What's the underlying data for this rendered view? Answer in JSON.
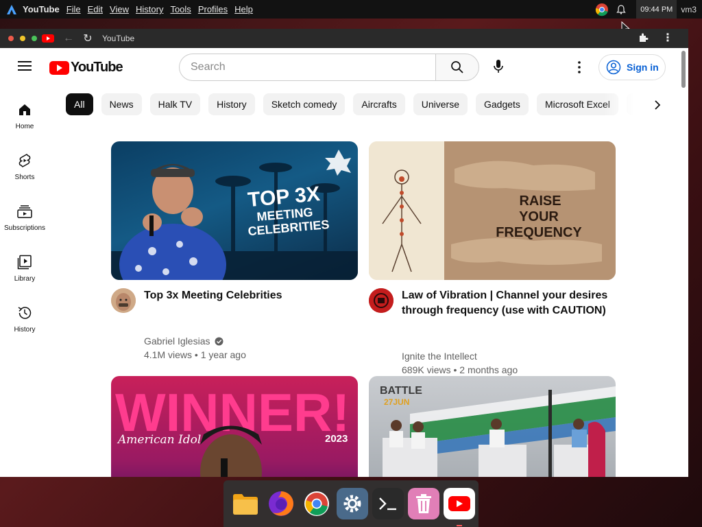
{
  "system_bar": {
    "app_name": "YouTube",
    "menu": [
      "File",
      "Edit",
      "View",
      "History",
      "Tools",
      "Profiles",
      "Help"
    ],
    "clock": "09:44 PM",
    "user": "vm3",
    "icons": [
      "chrome-icon",
      "bell-icon"
    ]
  },
  "browser": {
    "tab_title": "YouTube",
    "icons": [
      "back-arrow-icon",
      "reload-icon",
      "extensions-icon",
      "kebab-menu-icon"
    ]
  },
  "header": {
    "logo_text": "YouTube",
    "search_placeholder": "Search",
    "signin_label": "Sign in"
  },
  "chips": [
    "All",
    "News",
    "Halk TV",
    "History",
    "Sketch comedy",
    "Aircrafts",
    "Universe",
    "Gadgets",
    "Microsoft Excel"
  ],
  "sidebar": [
    {
      "label": "Home",
      "icon": "home-icon"
    },
    {
      "label": "Shorts",
      "icon": "shorts-icon"
    },
    {
      "label": "Subscriptions",
      "icon": "subscriptions-icon"
    },
    {
      "label": "Library",
      "icon": "library-icon"
    },
    {
      "label": "History",
      "icon": "history-icon"
    }
  ],
  "videos": [
    {
      "title": "Top 3x Meeting Celebrities",
      "channel": "Gabriel Iglesias",
      "verified": true,
      "views": "4.1M views",
      "age": "1 year ago",
      "thumb_text": [
        "TOP 3X",
        "MEETING",
        "CELEBRITIES"
      ]
    },
    {
      "title_lines": [
        "Law of Vibration | Channel your desires",
        "through frequency (use with CAUTION)"
      ],
      "channel": "Ignite the Intellect",
      "verified": false,
      "views": "689K views",
      "age": "2 months ago",
      "thumb_text": [
        "RAISE",
        "YOUR",
        "FREQUENCY"
      ]
    },
    {
      "thumb_text": [
        "WINNER!",
        "American Idol",
        "2023"
      ]
    },
    {
      "thumb_text": [
        "BATTLE",
        "27JUN"
      ]
    }
  ],
  "dock": [
    "files-icon",
    "firefox-icon",
    "chrome-icon",
    "settings-icon",
    "terminal-icon",
    "trash-icon",
    "youtube-icon"
  ]
}
